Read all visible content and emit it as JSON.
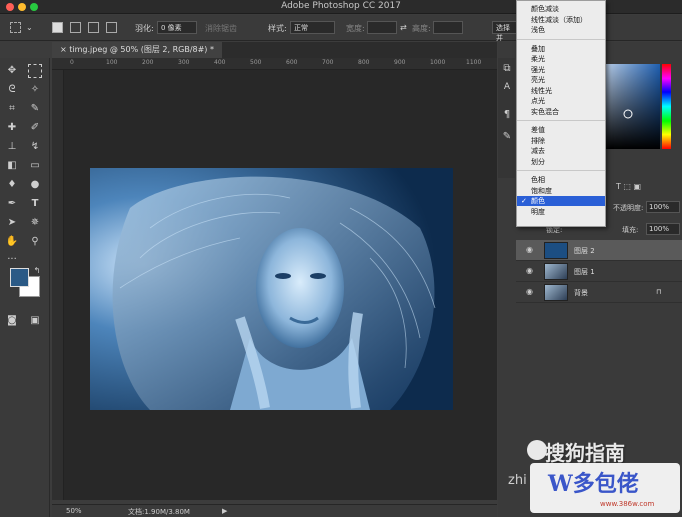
{
  "app": {
    "title": "Adobe Photoshop CC 2017"
  },
  "options": {
    "feather_label": "羽化:",
    "feather_value": "0 像素",
    "antialias_label": "消除锯齿",
    "style_label": "样式:",
    "style_value": "正常",
    "width_label": "宽度:",
    "height_label": "高度:",
    "select_mask_label": "选择并"
  },
  "document": {
    "tab_label": "timg.jpeg @ 50% (图层 2, RGB/8#) *",
    "close_symbol": "×"
  },
  "ruler": {
    "ticks": [
      "0",
      "100",
      "200",
      "300",
      "400",
      "500",
      "600",
      "700",
      "800",
      "900",
      "1000",
      "1100"
    ]
  },
  "status": {
    "zoom": "50%",
    "doc_size": "文档:1.90M/3.80M",
    "arrow": "▶"
  },
  "blend_menu": {
    "groups": [
      [
        "颜色减淡",
        "线性减淡（添加）",
        "浅色"
      ],
      [
        "叠加",
        "柔光",
        "强光",
        "亮光",
        "线性光",
        "点光",
        "实色混合"
      ],
      [
        "差值",
        "排除",
        "减去",
        "划分"
      ],
      [
        "色相",
        "饱和度",
        "颜色",
        "明度"
      ]
    ],
    "selected": "颜色",
    "check": "✓"
  },
  "layers_panel": {
    "opacity_label": "不透明度:",
    "opacity_value": "100%",
    "fill_label": "填充:",
    "fill_value": "100%",
    "lock_label": "锁定:",
    "kind_icons": "T ⬚ ▣",
    "layers": [
      {
        "name": "图层 2",
        "thumb": "color",
        "selected": true
      },
      {
        "name": "图层 1",
        "thumb": "photo",
        "selected": false
      },
      {
        "name": "背景",
        "thumb": "photo",
        "selected": false,
        "locked": true
      }
    ]
  },
  "colors": {
    "foreground": "#2b5a86",
    "background": "#ffffff",
    "selection": "#2a5fd6",
    "photo_tint": "#1c4e82"
  },
  "watermarks": {
    "sogou": "搜狗指南",
    "zhi": "zhi",
    "site": "W多包佬",
    "url": "www.386w.com"
  }
}
